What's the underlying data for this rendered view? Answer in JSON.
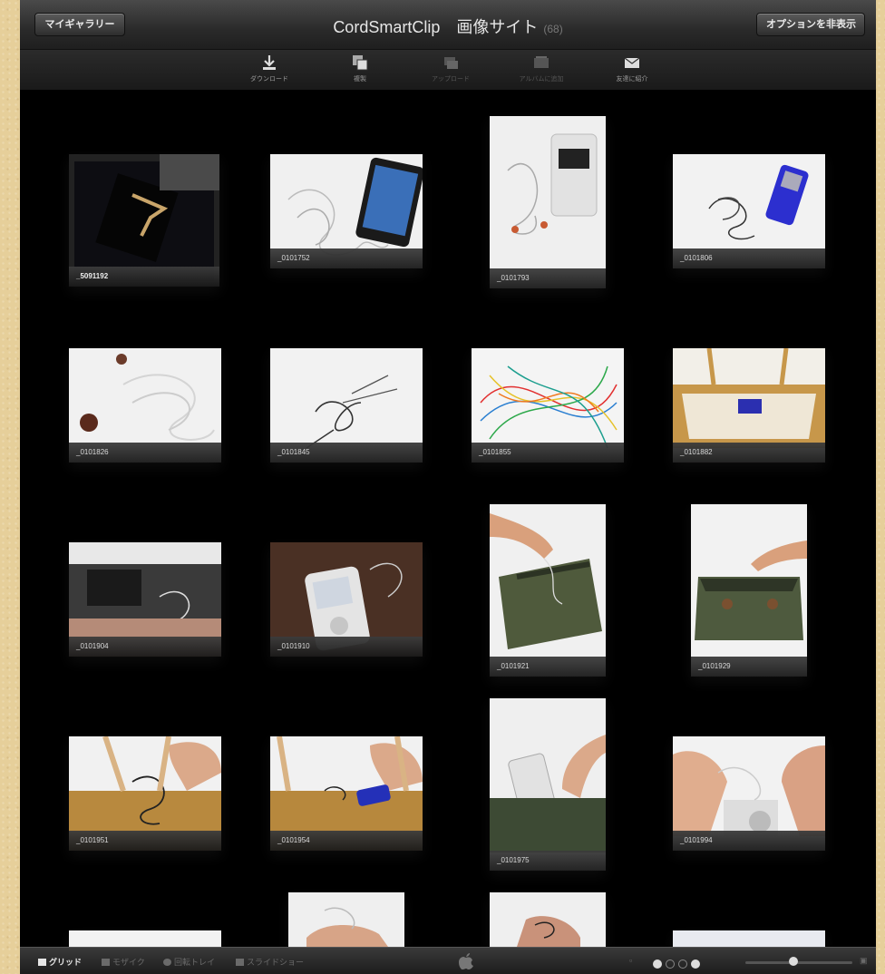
{
  "titlebar": {
    "left_button": "マイギャラリー",
    "title": "CordSmartClip　画像サイト",
    "count": "(68)",
    "right_button": "オプションを非表示"
  },
  "toolbar": {
    "items": [
      {
        "label": "ダウンロード",
        "icon": "download-icon"
      },
      {
        "label": "複製",
        "icon": "copy-icon"
      },
      {
        "label": "アップロード",
        "icon": "upload-icon"
      },
      {
        "label": "アルバムに追加",
        "icon": "album-icon"
      },
      {
        "label": "友達に紹介",
        "icon": "mail-icon"
      }
    ]
  },
  "photos": [
    {
      "caption": "_5091192"
    },
    {
      "caption": "_0101752"
    },
    {
      "caption": "_0101793"
    },
    {
      "caption": "_0101806"
    },
    {
      "caption": "_0101826"
    },
    {
      "caption": "_0101845"
    },
    {
      "caption": "_0101855"
    },
    {
      "caption": "_0101882"
    },
    {
      "caption": "_0101904"
    },
    {
      "caption": "_0101910"
    },
    {
      "caption": "_0101921"
    },
    {
      "caption": "_0101929"
    },
    {
      "caption": "_0101951"
    },
    {
      "caption": "_0101954"
    },
    {
      "caption": "_0101975"
    },
    {
      "caption": "_0101994"
    }
  ],
  "bottombar": {
    "grid_label": "グリッド",
    "mosaic_label": "モザイク",
    "carousel_label": "回転トレイ",
    "slideshow_label": "スライドショー"
  },
  "colors": {
    "background": "#e6cf9a",
    "window": "#000000",
    "bar": "#2a2a2a"
  }
}
